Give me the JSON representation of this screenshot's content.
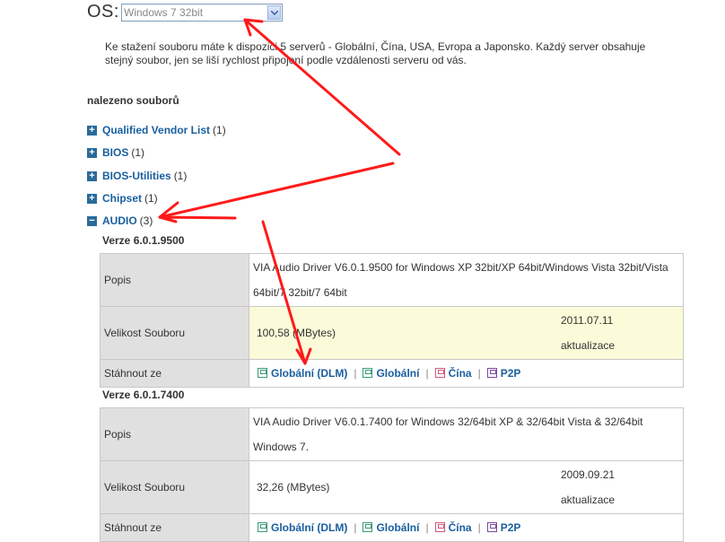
{
  "os": {
    "label": "OS:",
    "selected": "Windows 7 32bit"
  },
  "info_text": "Ke stažení souboru máte k dispozici 5 serverů - Globální, Čína, USA, Evropa a Japonsko. Každý server obsahuje stejný soubor, jen se liší rychlost připojení podle vzdálenosti serveru od vás.",
  "found_label": "nalezeno souborů",
  "categories": [
    {
      "name": "Qualified Vendor List",
      "count": "(1)",
      "toggle": "+"
    },
    {
      "name": "BIOS",
      "count": "(1)",
      "toggle": "+"
    },
    {
      "name": "BIOS-Utilities",
      "count": "(1)",
      "toggle": "+"
    },
    {
      "name": "Chipset",
      "count": "(1)",
      "toggle": "+"
    },
    {
      "name": "AUDIO",
      "count": "(3)",
      "toggle": "−"
    }
  ],
  "labels": {
    "popis": "Popis",
    "size": "Velikost Souboru",
    "download": "Stáhnout ze",
    "updated": "aktualizace"
  },
  "versions": [
    {
      "title": "Verze  6.0.1.9500",
      "description": "VIA Audio Driver V6.0.1.9500 for Windows XP 32bit/XP 64bit/Windows Vista 32bit/Vista 64bit/7 32bit/7 64bit",
      "size": "100,58 (MBytes)",
      "date": "2011.07.11"
    },
    {
      "title": "Verze  6.0.1.7400",
      "description": "VIA Audio Driver V6.0.1.7400 for Windows 32/64bit XP & 32/64bit Vista & 32/64bit Windows 7.",
      "size": "32,26 (MBytes)",
      "date": "2009.09.21"
    }
  ],
  "download_links": [
    "Globální (DLM)",
    "Globální",
    "Čína",
    "P2P"
  ],
  "colors": {
    "link": "#1a5fa0",
    "annotation": "#ff0000",
    "highlight": "#fbfbd9"
  }
}
